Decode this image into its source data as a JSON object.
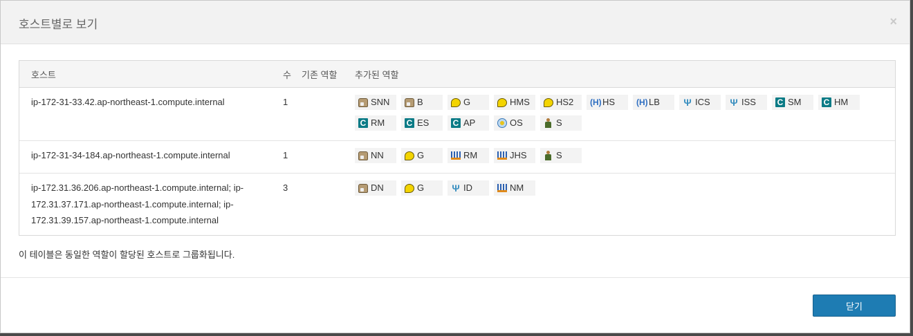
{
  "dialog": {
    "title": "호스트별로 보기",
    "close_icon": "×",
    "note": "이 테이블은 동일한 역할이 할당된 호스트로 그룹화됩니다.",
    "close_button": "닫기"
  },
  "table": {
    "headers": {
      "host": "호스트",
      "count": "수",
      "base_roles": "기존 역할",
      "added_roles": "추가된 역할"
    },
    "rows": [
      {
        "host": "ip-172-31-33.42.ap-northeast-1.compute.internal",
        "count": "1",
        "base_roles": "",
        "roles": [
          {
            "icon": "hdfs-icon",
            "label": "SNN"
          },
          {
            "icon": "hdfs-icon",
            "label": "B"
          },
          {
            "icon": "hive-bee-icon",
            "label": "G"
          },
          {
            "icon": "hive-bee-icon",
            "label": "HMS"
          },
          {
            "icon": "hive-bee-icon",
            "label": "HS2"
          },
          {
            "icon": "hue-icon",
            "label": "HS"
          },
          {
            "icon": "hue-icon",
            "label": "LB"
          },
          {
            "icon": "impala-fork-icon",
            "label": "ICS"
          },
          {
            "icon": "impala-fork-icon",
            "label": "ISS"
          },
          {
            "icon": "cloudera-c-icon",
            "label": "SM"
          },
          {
            "icon": "cloudera-c-icon",
            "label": "HM"
          },
          {
            "icon": "cloudera-c-icon",
            "label": "RM"
          },
          {
            "icon": "cloudera-c-icon",
            "label": "ES"
          },
          {
            "icon": "cloudera-c-icon",
            "label": "AP"
          },
          {
            "icon": "oozie-icon",
            "label": "OS"
          },
          {
            "icon": "spark-man-icon",
            "label": "S"
          }
        ]
      },
      {
        "host": "ip-172-31-34-184.ap-northeast-1.compute.internal",
        "count": "1",
        "base_roles": "",
        "roles": [
          {
            "icon": "hdfs-icon",
            "label": "NN"
          },
          {
            "icon": "hive-bee-icon",
            "label": "G"
          },
          {
            "icon": "yarn-grid-icon",
            "label": "RM"
          },
          {
            "icon": "yarn-grid-icon",
            "label": "JHS"
          },
          {
            "icon": "spark-man-icon",
            "label": "S"
          }
        ]
      },
      {
        "host_lines": [
          "ip-172.31.36.206.ap-northeast-1.compute.internal; ip-",
          "172.31.37.171.ap-northeast-1.compute.internal; ip-",
          "172.31.39.157.ap-northeast-1.compute.internal"
        ],
        "count": "3",
        "base_roles": "",
        "roles": [
          {
            "icon": "hdfs-icon",
            "label": "DN"
          },
          {
            "icon": "hive-bee-icon",
            "label": "G"
          },
          {
            "icon": "impala-fork-icon",
            "label": "ID"
          },
          {
            "icon": "yarn-grid-icon",
            "label": "NM"
          }
        ]
      }
    ]
  }
}
